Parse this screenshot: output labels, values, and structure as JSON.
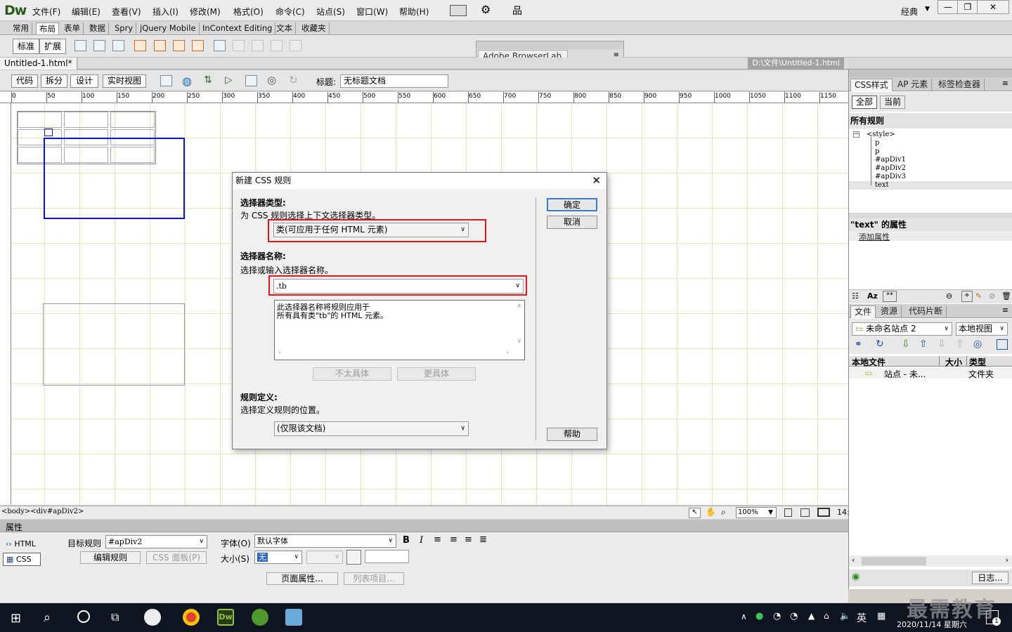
{
  "menubar": {
    "logo": "Dw",
    "items": [
      "文件(F)",
      "编辑(E)",
      "查看(V)",
      "插入(I)",
      "修改(M)",
      "格式(O)",
      "命令(C)",
      "站点(S)",
      "窗口(W)",
      "帮助(H)"
    ],
    "workspace": "经典"
  },
  "insert_tabs": [
    "常用",
    "布局",
    "表单",
    "数据",
    "Spry",
    "jQuery Mobile",
    "InContext Editing",
    "文本",
    "收藏夹"
  ],
  "insert_toolbar": {
    "std_label": "标准",
    "ext_label": "扩展"
  },
  "browserlab": {
    "label": "Adobe BrowserLab"
  },
  "document": {
    "tab": "Untitled-1.html*",
    "path": "D:\\文件\\Untitled-1.html",
    "views": [
      "代码",
      "拆分",
      "设计",
      "实时视图"
    ],
    "title_label": "标题:",
    "title_value": "无标题文档"
  },
  "ruler": {
    "h_marks": [
      "0",
      "50",
      "100",
      "150",
      "200",
      "250",
      "300",
      "350",
      "400",
      "450",
      "500",
      "550",
      "600",
      "650",
      "700",
      "750",
      "800",
      "850",
      "900",
      "950",
      "1000",
      "1050",
      "1100",
      "1150"
    ]
  },
  "statusbar": {
    "tags": "<body><div#apDiv2>",
    "zoom": "100%",
    "size": "14:"
  },
  "properties": {
    "header": "属性",
    "html_label": "HTML",
    "css_label": "CSS",
    "target_rule_label": "目标规则",
    "target_rule_value": "#apDiv2",
    "edit_rule": "编辑规则",
    "css_panel": "CSS 面板(P)",
    "font_label": "字体(O)",
    "font_value": "默认字体",
    "size_label": "大小(S)",
    "size_value": "无",
    "page_props": "页面属性...",
    "list_item": "列表项目..."
  },
  "css_panel": {
    "tabs": [
      "CSS样式",
      "AP 元素",
      "标签检查器"
    ],
    "modes": [
      "全部",
      "当前"
    ],
    "all_rules": "所有规则",
    "rules": [
      "<style>",
      "p",
      "p",
      "#apDiv1",
      "#apDiv2",
      "#apDiv3",
      "text"
    ],
    "props_title": "\"text\" 的属性",
    "add_prop": "添加属性"
  },
  "files_panel": {
    "tabs": [
      "文件",
      "资源",
      "代码片断"
    ],
    "site": "未命名站点 2",
    "view": "本地视图",
    "cols": [
      "本地文件",
      "大小",
      "类型"
    ],
    "row_name": "站点 - 未...",
    "row_type": "文件夹",
    "log": "日志..."
  },
  "dialog": {
    "title": "新建 CSS 规则",
    "sel_type_heading": "选择器类型:",
    "sel_type_desc": "为 CSS 规则选择上下文选择器类型。",
    "sel_type_value": "类(可应用于任何 HTML 元素)",
    "sel_name_heading": "选择器名称:",
    "sel_name_desc": "选择或输入选择器名称。",
    "sel_name_value": ".tb",
    "desc_line1": "此选择器名称将规则应用于",
    "desc_line2": "所有具有类\"tb\"的 HTML 元素。",
    "less_specific": "不太具体",
    "more_specific": "更具体",
    "rule_def_heading": "规则定义:",
    "rule_def_desc": "选择定义规则的位置。",
    "rule_def_value": "(仅限该文档)",
    "ok": "确定",
    "cancel": "取消",
    "help": "帮助"
  },
  "taskbar": {
    "ime": "英",
    "datetime": "2020/11/14 星期六",
    "notification_count": "1"
  },
  "watermark": "最需教育",
  "colors": {
    "accent_blue": "#0a14d8",
    "highlight_red": "#e0161b",
    "taskbar": "#0e1520",
    "dw_green": "#2a5b1a"
  }
}
